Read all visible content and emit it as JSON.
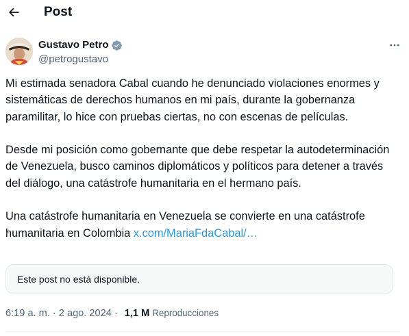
{
  "header": {
    "title": "Post",
    "back_icon": "arrow-left-icon"
  },
  "author": {
    "name": "Gustavo Petro",
    "handle": "@petrogustavo",
    "verified_icon": "verified-badge-icon",
    "verified_color": "#829aab",
    "more_icon": "more-horizontal-icon"
  },
  "post": {
    "paragraphs": [
      "Mi estimada senadora Cabal cuando he denunciado violaciones enormes y sistemáticas de derechos humanos en mi país, durante la gobernanza paramilitar, lo hice con pruebas ciertas, no con escenas de películas.",
      "Desde mi posición como gobernante que debe respetar la autodeterminación de Venezuela, busco caminos diplomáticos y políticos para detener a través del diálogo, una catástrofe humanitaria en el hermano país.",
      "Una catástrofe humanitaria en Venezuela se convierte en una catástrofe humanitaria en Colombia"
    ],
    "link_text": "x.com/MariaFdaCabal/…",
    "link_color": "#1d9bf0"
  },
  "quote": {
    "unavailable_text": "Este post no está disponible."
  },
  "meta": {
    "time": "6:19 a. m.",
    "separator": "·",
    "date": "2 ago. 2024",
    "views_count": "1,1 M",
    "views_label": "Reproducciones"
  }
}
